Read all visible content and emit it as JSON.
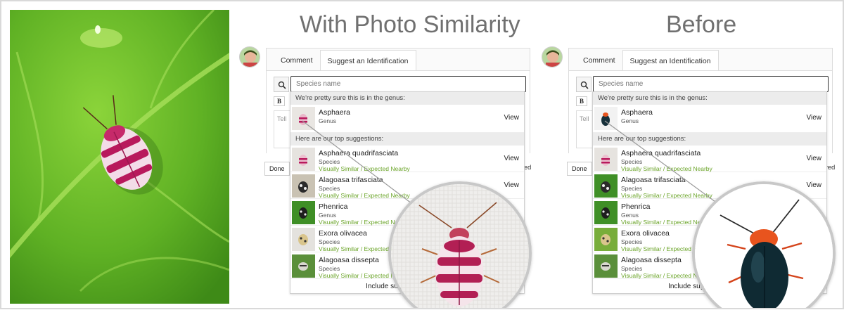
{
  "titles": {
    "left": "With Photo Similarity",
    "right": "Before"
  },
  "tabs": {
    "comment": "Comment",
    "suggest": "Suggest an Identification"
  },
  "search": {
    "placeholder": "Species name"
  },
  "editor": {
    "bold_label": "B",
    "textarea_placeholder": "Tell"
  },
  "buttons": {
    "done": "Done",
    "trail": "ved"
  },
  "dropdown": {
    "genus_header": "We're pretty sure this is in the genus:",
    "suggestions_header": "Here are our top suggestions:",
    "footer": "Include suggestio",
    "view_label": "View",
    "genus": {
      "name": "Asphaera",
      "rank": "Genus"
    },
    "items": [
      {
        "name": "Asphaera quadrifasciata",
        "rank": "Species",
        "similarity": "Visually Similar / Expected Nearby"
      },
      {
        "name": "Alagoasa trifasciata",
        "rank": "Species",
        "similarity": "Visually Similar / Expected Nearby"
      },
      {
        "name": "Phenrica",
        "rank": "Genus",
        "similarity": "Visually Similar / Expected Nearby"
      },
      {
        "name": "Exora olivacea",
        "rank": "Species",
        "similarity": "Visually Similar / Expected Nearby"
      },
      {
        "name": "Alagoasa dissepta",
        "rank": "Species",
        "similarity": "Visually Similar / Expected Nearby"
      }
    ]
  },
  "colors": {
    "similarity_green": "#6aa428",
    "title_gray": "#707070",
    "leaf_green": "#4e9a1f"
  },
  "icons": {
    "search": "search-icon",
    "bold": "bold-icon"
  }
}
